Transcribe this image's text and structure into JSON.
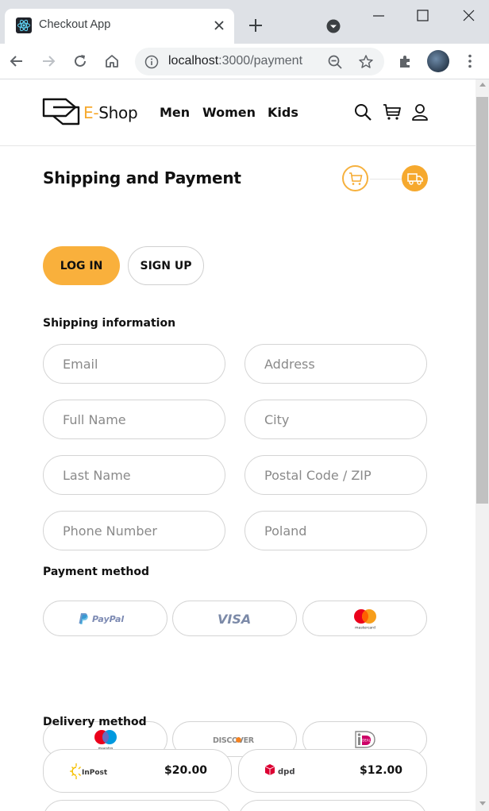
{
  "browser": {
    "tab_title": "Checkout App",
    "url_host": "localhost",
    "url_path": ":3000/payment"
  },
  "navbar": {
    "logo_prefix": "E-",
    "logo_suffix": "Shop",
    "links": [
      "Men",
      "Women",
      "Kids"
    ]
  },
  "checkout": {
    "title": "Shipping and Payment",
    "login_label": "LOG IN",
    "signup_label": "SIGN UP",
    "shipping_heading": "Shipping information",
    "fields": {
      "email": "Email",
      "address": "Address",
      "full_name": "Full Name",
      "city": "City",
      "last_name": "Last Name",
      "postal": "Postal Code / ZIP",
      "phone": "Phone Number",
      "country": "Poland"
    },
    "payment_heading": "Payment method",
    "payment_methods": [
      "PayPal",
      "VISA",
      "mastercard",
      "maestro",
      "DISCOVER",
      "iDEAL"
    ],
    "delivery_heading": "Delivery method",
    "delivery": [
      {
        "carrier": "InPost",
        "price": "$20.00"
      },
      {
        "carrier": "dpd",
        "price": "$12.00"
      }
    ]
  },
  "colors": {
    "accent": "#f9b03c",
    "border": "#d4d4d4"
  }
}
